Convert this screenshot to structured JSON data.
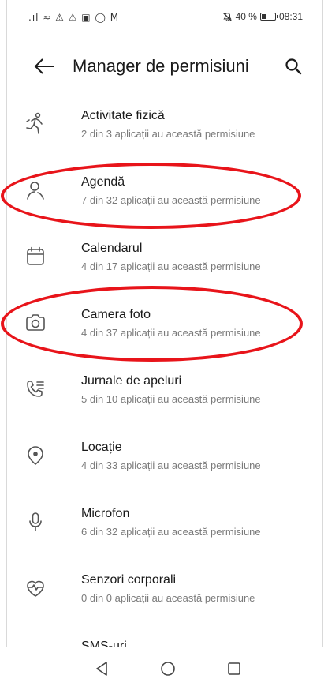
{
  "status_bar": {
    "left_icons": ".ıl ≈ ⚠ ⚠ ▣ ◯ M",
    "battery_percent": "40 %",
    "battery_level": 0.4,
    "time": "08:31"
  },
  "header": {
    "title": "Manager de permisiuni"
  },
  "permissions": [
    {
      "name": "Activitate fizică",
      "detail": "2 din 3 aplicații au această permisiune",
      "icon": "running-person-icon"
    },
    {
      "name": "Agendă",
      "detail": "7 din 32 aplicații au această permisiune",
      "icon": "contacts-icon"
    },
    {
      "name": "Calendarul",
      "detail": "4 din 17 aplicații au această permisiune",
      "icon": "calendar-icon"
    },
    {
      "name": "Camera foto",
      "detail": "4 din 37 aplicații au această permisiune",
      "icon": "camera-icon"
    },
    {
      "name": "Jurnale de apeluri",
      "detail": "5 din 10 aplicații au această permisiune",
      "icon": "call-log-icon"
    },
    {
      "name": "Locație",
      "detail": "4 din 33 aplicații au această permisiune",
      "icon": "location-icon"
    },
    {
      "name": "Microfon",
      "detail": "6 din 32 aplicații au această permisiune",
      "icon": "microphone-icon"
    },
    {
      "name": "Senzori corporali",
      "detail": "0 din 0 aplicații au această permisiune",
      "icon": "heart-sensor-icon"
    },
    {
      "name": "SMS-uri",
      "detail": "",
      "icon": "sms-icon"
    }
  ],
  "colors": {
    "annotation": "#e8141a",
    "icon": "#555555",
    "subtitle": "#7a7a7a"
  }
}
